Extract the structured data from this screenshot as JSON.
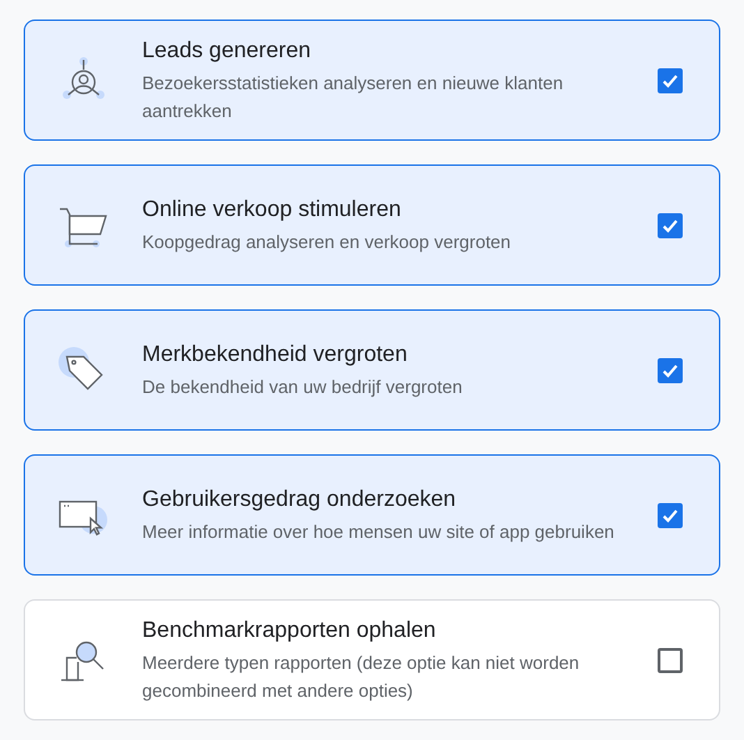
{
  "options": [
    {
      "kind": "leads",
      "title": "Leads genereren",
      "description": "Bezoekersstatistieken analyseren en nieuwe klanten aantrekken",
      "checked": true
    },
    {
      "kind": "sales",
      "title": "Online verkoop stimuleren",
      "description": "Koopgedrag analyseren en verkoop vergroten",
      "checked": true
    },
    {
      "kind": "brand",
      "title": "Merkbekendheid vergroten",
      "description": "De bekendheid van uw bedrijf vergroten",
      "checked": true
    },
    {
      "kind": "behavior",
      "title": "Gebruikersgedrag onderzoeken",
      "description": "Meer informatie over hoe mensen uw site of app gebruiken",
      "checked": true
    },
    {
      "kind": "benchmark",
      "title": "Benchmarkrapporten ophalen",
      "description": "Meerdere typen rapporten (deze optie kan niet worden gecombineerd met andere opties)",
      "checked": false
    }
  ]
}
